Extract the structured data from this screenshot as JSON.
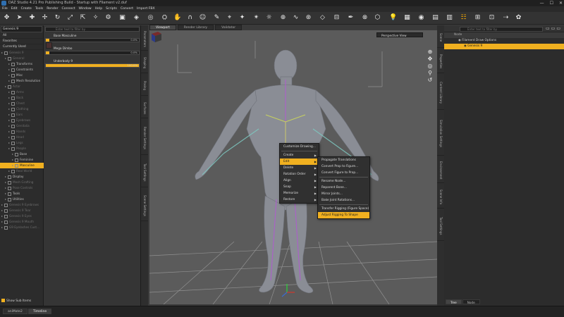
{
  "window": {
    "title": "DAZ Studio 4.21 Pro Publishing Build - Startup with Filament v2.duf"
  },
  "menubar": [
    "File",
    "Edit",
    "Create",
    "Tools",
    "Render",
    "Connect",
    "Window",
    "Help",
    "Scripts",
    "Convert",
    "Import FBX"
  ],
  "left": {
    "figure_dropdown": "Genesis 9",
    "categories": [
      "All",
      "Favorites",
      "Currently Used"
    ],
    "tree": [
      {
        "label": "Genesis 9",
        "dim": true,
        "indent": 0
      },
      {
        "label": "General",
        "dim": true,
        "indent": 1
      },
      {
        "label": "Transforms",
        "dim": false,
        "indent": 2
      },
      {
        "label": "Constraints",
        "dim": false,
        "indent": 2
      },
      {
        "label": "Misc",
        "dim": false,
        "indent": 2
      },
      {
        "label": "Mesh Resolution",
        "dim": false,
        "indent": 2
      },
      {
        "label": "Actor",
        "dim": true,
        "indent": 1
      },
      {
        "label": "Arms",
        "dim": true,
        "indent": 2
      },
      {
        "label": "Back",
        "dim": true,
        "indent": 2
      },
      {
        "label": "Chest",
        "dim": true,
        "indent": 2
      },
      {
        "label": "Clothing",
        "dim": true,
        "indent": 2
      },
      {
        "label": "Ears",
        "dim": true,
        "indent": 2
      },
      {
        "label": "Eyebrows",
        "dim": true,
        "indent": 2
      },
      {
        "label": "Genitalia",
        "dim": true,
        "indent": 2
      },
      {
        "label": "Hands",
        "dim": true,
        "indent": 2
      },
      {
        "label": "Head",
        "dim": true,
        "indent": 2
      },
      {
        "label": "Legs",
        "dim": true,
        "indent": 2
      },
      {
        "label": "People",
        "dim": true,
        "indent": 2
      },
      {
        "label": "Base",
        "dim": false,
        "indent": 3
      },
      {
        "label": "Feminine",
        "dim": false,
        "indent": 3
      },
      {
        "label": "Masculine",
        "dim": false,
        "indent": 3,
        "selected": true
      },
      {
        "label": "Real World",
        "dim": true,
        "indent": 2
      },
      {
        "label": "Display",
        "dim": false,
        "indent": 1
      },
      {
        "label": "Mesh Grafting",
        "dim": true,
        "indent": 1
      },
      {
        "label": "Pose Controls",
        "dim": true,
        "indent": 1
      },
      {
        "label": "Tools",
        "dim": false,
        "indent": 1
      },
      {
        "label": "Utilities",
        "dim": false,
        "indent": 1
      },
      {
        "label": "Genesis 9 Eyebrows",
        "dim": true,
        "indent": 0
      },
      {
        "label": "Genesis 9 Tear",
        "dim": true,
        "indent": 0
      },
      {
        "label": "Genesis 9 Eyes",
        "dim": true,
        "indent": 0
      },
      {
        "label": "Genesis 9 Mouth",
        "dim": true,
        "indent": 0
      },
      {
        "label": "G9 Eyelashes Cust...",
        "dim": true,
        "indent": 0
      }
    ],
    "show_sub_items": "Show Sub Items"
  },
  "parameters": {
    "search_placeholder": "Enter text to filter by",
    "items": [
      {
        "label": "Base Masculine",
        "value": "0.0%",
        "fill": 0.0
      },
      {
        "label": "Mega Dimbo",
        "value": "0.0%",
        "fill": 0.0
      },
      {
        "label": "Underbody 9",
        "value": "100.0%",
        "fill": 1.0
      }
    ]
  },
  "left_vtabs": [
    "Parameters",
    "Shaping",
    "Posing",
    "Surfaces",
    "Render Settings",
    "Tool Settings",
    "Scene Settings"
  ],
  "viewport": {
    "tabs": [
      "Viewport",
      "Render Library",
      "Validator"
    ],
    "active_tab": "Viewport",
    "camera": "Perspective View"
  },
  "context_menu": {
    "items": [
      {
        "label": "Customize Drawing...",
        "submenu": false
      },
      {
        "label": "Create",
        "submenu": true
      },
      {
        "label": "Edit",
        "submenu": true,
        "highlighted": true
      },
      {
        "label": "Delete",
        "submenu": true
      },
      {
        "label": "Rotation Order",
        "submenu": true
      },
      {
        "label": "Align",
        "submenu": true
      },
      {
        "label": "Snap",
        "submenu": true
      },
      {
        "label": "Memorize",
        "submenu": true
      },
      {
        "label": "Restore",
        "submenu": true
      }
    ],
    "submenu": [
      {
        "label": "Propagate Translations",
        "highlighted": false
      },
      {
        "label": "Convert Prop to Figure...",
        "highlighted": false
      },
      {
        "label": "Convert Figure to Prop...",
        "highlighted": false
      },
      {
        "label": "Rename Node...",
        "highlighted": false
      },
      {
        "label": "Reparent Bone...",
        "highlighted": false
      },
      {
        "label": "Mirror Joints...",
        "highlighted": false
      },
      {
        "label": "Bake Joint Rotations...",
        "highlighted": false
      },
      {
        "label": "Transfer Rigging (Figure Space)",
        "highlighted": false
      },
      {
        "label": "Adjust Rigging To Shape",
        "highlighted": true
      }
    ]
  },
  "right_vtabs": [
    "Scene",
    "Properties",
    "Content Library",
    "Simulation Settings",
    "Environment",
    "Scene Info",
    "Tool Settings"
  ],
  "scene": {
    "search_placeholder": "Enter text to filter by",
    "header": "Node",
    "rows": [
      {
        "label": "Filament Draw Options",
        "highlighted": false
      },
      {
        "label": "Genesis 9",
        "highlighted": true
      }
    ],
    "tabs": [
      "Tree",
      "Node"
    ],
    "active_tab": "Tree"
  },
  "bottombar": {
    "tabs": [
      "aniMate2",
      "Timeline"
    ],
    "active": "Timeline"
  },
  "colors": {
    "accent": "#f0b020",
    "panel": "#2c2c2c",
    "viewport": "#5b5b5b"
  }
}
